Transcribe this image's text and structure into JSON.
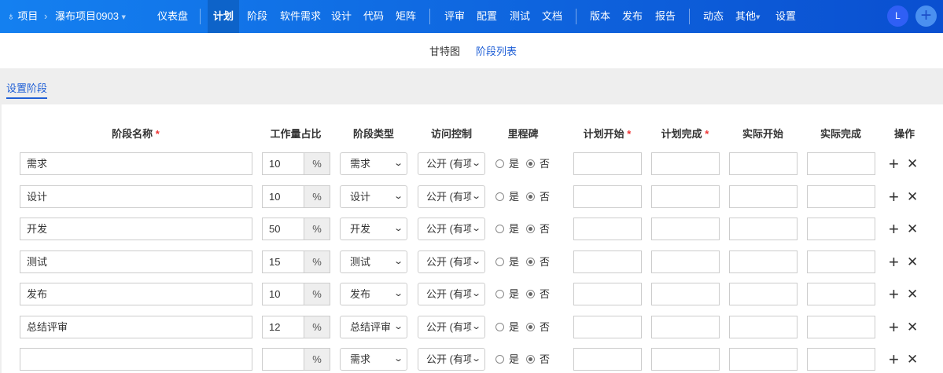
{
  "nav": {
    "project": "项目",
    "project_name": "瀑布项目0903",
    "items": [
      "仪表盘",
      "计划",
      "阶段",
      "软件需求",
      "设计",
      "代码",
      "矩阵",
      "评审",
      "配置",
      "测试",
      "文档",
      "版本",
      "发布",
      "报告",
      "动态",
      "其他",
      "设置"
    ],
    "active": "计划",
    "avatar": "L"
  },
  "subnav": {
    "tabs": [
      "甘特图",
      "阶段列表"
    ],
    "active": "阶段列表"
  },
  "tab": "设置阶段",
  "headers": {
    "name": "阶段名称",
    "ratio": "工作量占比",
    "type": "阶段类型",
    "access": "访问控制",
    "milestone": "里程碑",
    "plan_start": "计划开始",
    "plan_end": "计划完成",
    "actual_start": "实际开始",
    "actual_end": "实际完成",
    "ops": "操作",
    "required": "*"
  },
  "labels": {
    "percent": "%",
    "yes": "是",
    "no": "否",
    "add": "+",
    "remove": "✕"
  },
  "rows": [
    {
      "name": "需求",
      "ratio": "10",
      "type": "需求",
      "access": "公开 (有项"
    },
    {
      "name": "设计",
      "ratio": "10",
      "type": "设计",
      "access": "公开 (有项"
    },
    {
      "name": "开发",
      "ratio": "50",
      "type": "开发",
      "access": "公开 (有项"
    },
    {
      "name": "测试",
      "ratio": "15",
      "type": "测试",
      "access": "公开 (有项"
    },
    {
      "name": "发布",
      "ratio": "10",
      "type": "发布",
      "access": "公开 (有项"
    },
    {
      "name": "总结评审",
      "ratio": "12",
      "type": "总结评审",
      "access": "公开 (有项"
    },
    {
      "name": "",
      "ratio": "",
      "type": "需求",
      "access": "公开 (有项"
    }
  ]
}
